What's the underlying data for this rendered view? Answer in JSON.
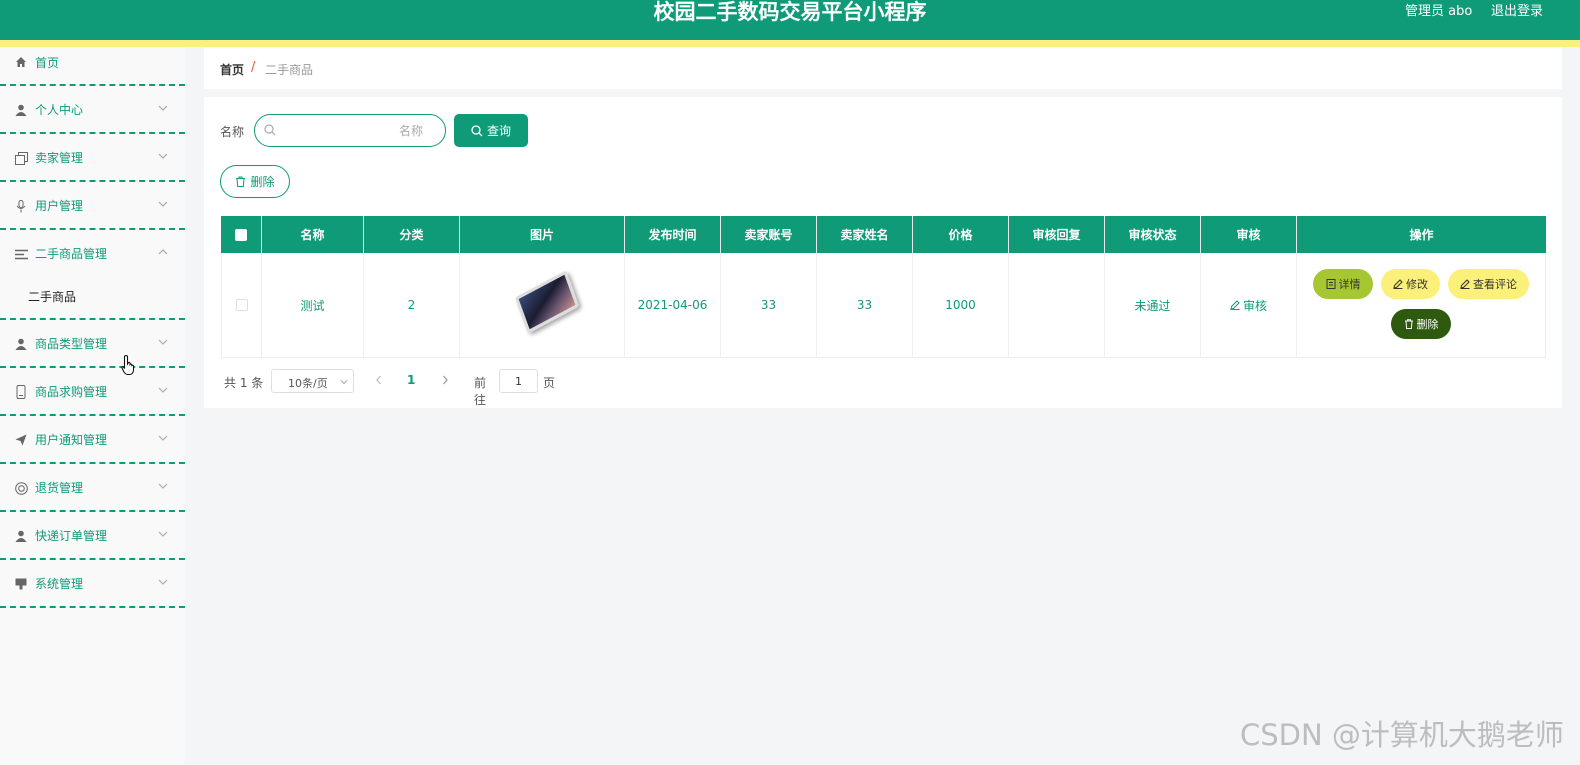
{
  "header": {
    "title": "校园二手数码交易平台小程序",
    "admin": "管理员 abo",
    "logout": "退出登录",
    "brand_color": "#0f9a78",
    "accent_color": "#fbf07a"
  },
  "sidebar": {
    "items": [
      {
        "label": "首页",
        "icon": "home-icon"
      },
      {
        "label": "个人中心",
        "icon": "user-icon"
      },
      {
        "label": "卖家管理",
        "icon": "copy-icon"
      },
      {
        "label": "用户管理",
        "icon": "mic-icon"
      },
      {
        "label": "二手商品管理",
        "icon": "list-icon"
      },
      {
        "label": "二手商品",
        "icon": ""
      },
      {
        "label": "商品类型管理",
        "icon": "user-icon"
      },
      {
        "label": "商品求购管理",
        "icon": "phone-icon"
      },
      {
        "label": "用户通知管理",
        "icon": "send-icon"
      },
      {
        "label": "退货管理",
        "icon": "lifebuoy-icon"
      },
      {
        "label": "快递订单管理",
        "icon": "user-icon"
      },
      {
        "label": "系统管理",
        "icon": "monitor-icon"
      }
    ]
  },
  "breadcrumb": {
    "home": "首页",
    "separator": "/",
    "current": "二手商品"
  },
  "search": {
    "label": "名称",
    "placeholder": "名称",
    "button": "查询"
  },
  "actions": {
    "delete": "删除"
  },
  "table": {
    "columns": [
      "名称",
      "分类",
      "图片",
      "发布时间",
      "卖家账号",
      "卖家姓名",
      "价格",
      "审核回复",
      "审核状态",
      "审核",
      "操作"
    ],
    "rows": [
      {
        "name": "测试",
        "category": "2",
        "publish_time": "2021-04-06",
        "seller_account": "33",
        "seller_name": "33",
        "price": "1000",
        "audit_reply": "",
        "audit_status": "未通过",
        "audit_action": "审核",
        "ops": {
          "detail": "详情",
          "edit": "修改",
          "comments": "查看评论",
          "delete": "删除"
        }
      }
    ]
  },
  "pagination": {
    "total": "共 1 条",
    "page_size": "10条/页",
    "current_page": "1",
    "goto_label": "前往",
    "goto_value": "1",
    "page_suffix": "页"
  },
  "watermark": "CSDN @计算机大鹅老师"
}
